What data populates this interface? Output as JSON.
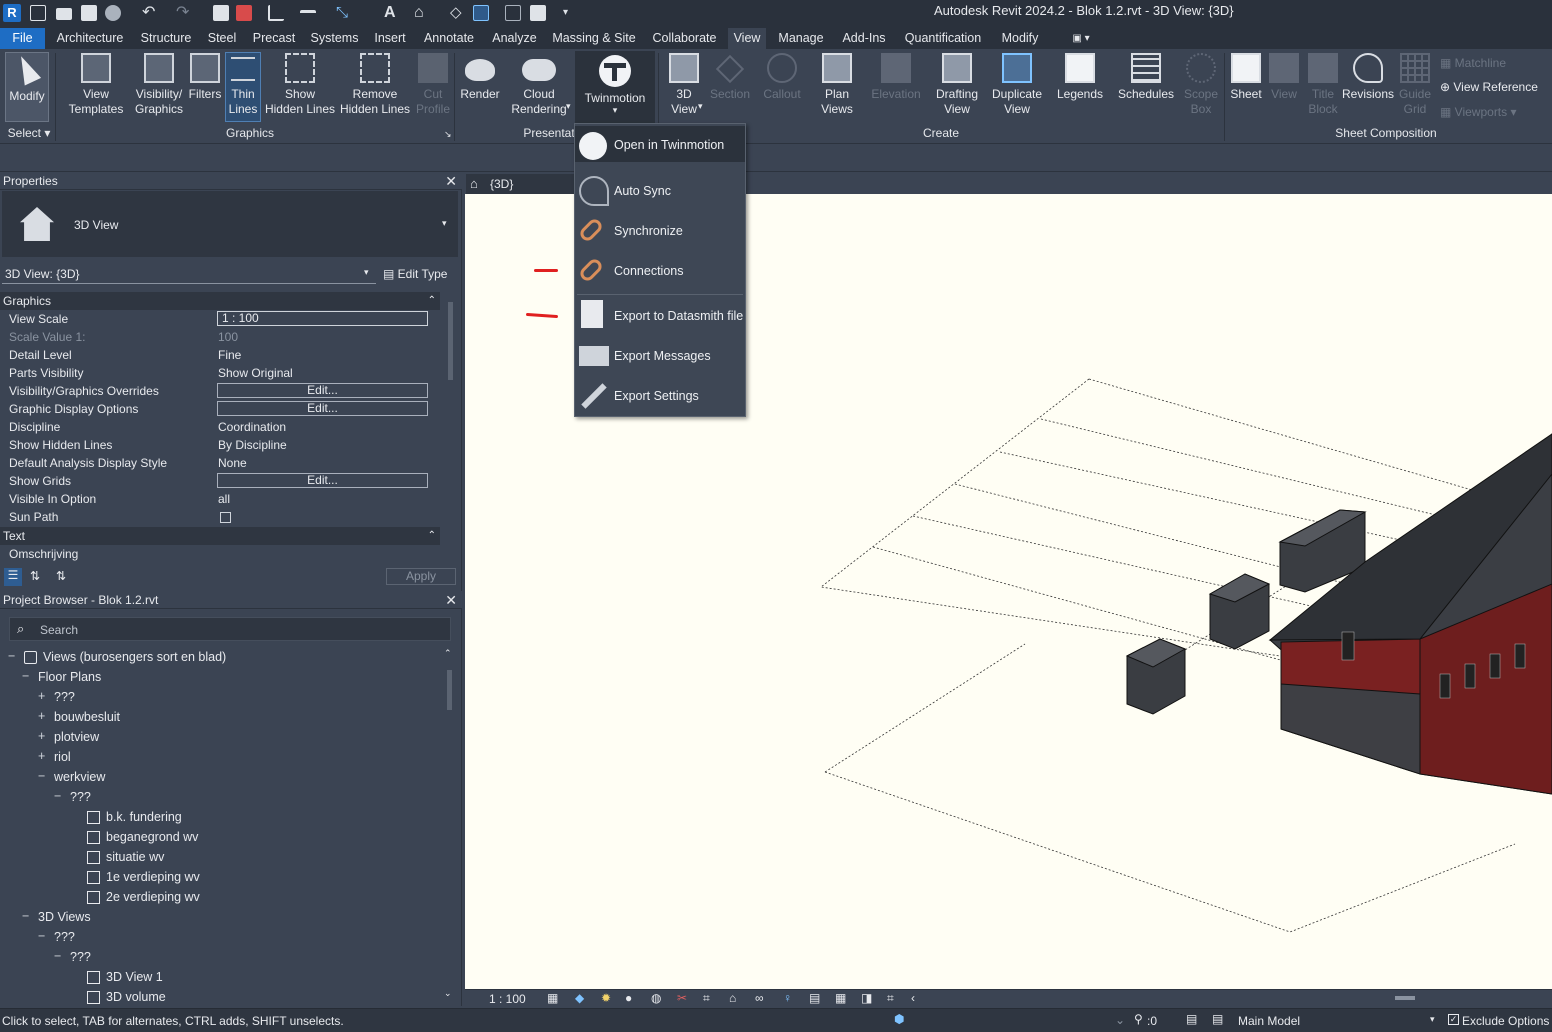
{
  "app_title": "Autodesk Revit 2024.2 - Blok 1.2.rvt - 3D View: {3D}",
  "menu": [
    "File",
    "Architecture",
    "Structure",
    "Steel",
    "Precast",
    "Systems",
    "Insert",
    "Annotate",
    "Analyze",
    "Massing & Site",
    "Collaborate",
    "View",
    "Manage",
    "Add-Ins",
    "Quantification",
    "Modify"
  ],
  "ribbon": {
    "modify": "Modify",
    "select": "Select",
    "view_templates": [
      "View",
      "Templates"
    ],
    "visibility": [
      "Visibility/",
      "Graphics"
    ],
    "filters": "Filters",
    "thin_lines": [
      "Thin",
      "Lines"
    ],
    "show_hidden": [
      "Show",
      "Hidden Lines"
    ],
    "remove_hidden": [
      "Remove",
      "Hidden Lines"
    ],
    "cut_profile": [
      "Cut",
      "Profile"
    ],
    "graphics_panel": "Graphics",
    "render": "Render",
    "cloud_rendering": [
      "Cloud",
      "Rendering"
    ],
    "twinmotion": "Twinmotion",
    "presentation_panel": "Presentat",
    "view3d": [
      "3D",
      "View"
    ],
    "section": "Section",
    "callout": "Callout",
    "plan_views": [
      "Plan",
      "Views"
    ],
    "elevation": "Elevation",
    "drafting_view": [
      "Drafting",
      "View"
    ],
    "duplicate_view": [
      "Duplicate",
      "View"
    ],
    "legends": "Legends",
    "schedules": "Schedules",
    "scope_box": [
      "Scope",
      "Box"
    ],
    "create_panel": "Create",
    "sheet": "Sheet",
    "view": "View",
    "title_block": [
      "Title",
      "Block"
    ],
    "revisions": "Revisions",
    "guide_grid": [
      "Guide",
      "Grid"
    ],
    "matchline": "Matchline",
    "view_reference": "View  Reference",
    "viewports": "Viewports",
    "sheet_comp_panel": "Sheet Composition"
  },
  "twinmotion_menu": [
    "Open in Twinmotion",
    "Auto Sync",
    "Synchronize",
    "Connections",
    "Export to Datasmith file",
    "Export Messages",
    "Export Settings"
  ],
  "properties": {
    "title": "Properties",
    "type_name": "3D View",
    "instance": "3D View: {3D}",
    "edit_type": "Edit Type",
    "group_graphics": "Graphics",
    "rows": [
      {
        "k": "View Scale",
        "v": "1 : 100",
        "kind": "input"
      },
      {
        "k": "Scale Value    1:",
        "v": "100",
        "kind": "dim"
      },
      {
        "k": "Detail Level",
        "v": "Fine"
      },
      {
        "k": "Parts Visibility",
        "v": "Show Original"
      },
      {
        "k": "Visibility/Graphics Overrides",
        "v": "Edit...",
        "kind": "btn"
      },
      {
        "k": "Graphic Display Options",
        "v": "Edit...",
        "kind": "btn"
      },
      {
        "k": "Discipline",
        "v": "Coordination"
      },
      {
        "k": "Show Hidden Lines",
        "v": "By Discipline"
      },
      {
        "k": "Default Analysis Display Style",
        "v": "None"
      },
      {
        "k": "Show Grids",
        "v": "Edit...",
        "kind": "btn"
      },
      {
        "k": "Visible In Option",
        "v": "all"
      },
      {
        "k": "Sun Path",
        "v": "",
        "kind": "check"
      }
    ],
    "group_text": "Text",
    "omschrijving": "Omschrijving",
    "apply": "Apply"
  },
  "browser": {
    "title": "Project Browser - Blok 1.2.rvt",
    "search_placeholder": "Search",
    "nodes": [
      {
        "t": "Views (burosengers sort en blad)",
        "lvl": 0,
        "tw": "−",
        "icon": true
      },
      {
        "t": "Floor Plans",
        "lvl": 1,
        "tw": "−"
      },
      {
        "t": "???",
        "lvl": 2,
        "tw": "+"
      },
      {
        "t": "bouwbesluit",
        "lvl": 2,
        "tw": "+"
      },
      {
        "t": "plotview",
        "lvl": 2,
        "tw": "+"
      },
      {
        "t": "riol",
        "lvl": 2,
        "tw": "+"
      },
      {
        "t": "werkview",
        "lvl": 2,
        "tw": "−"
      },
      {
        "t": "???",
        "lvl": 3,
        "tw": "−"
      },
      {
        "t": "b.k. fundering",
        "lvl": 4,
        "sheet": true
      },
      {
        "t": "beganegrond wv",
        "lvl": 4,
        "sheet": true
      },
      {
        "t": "situatie wv",
        "lvl": 4,
        "sheet": true
      },
      {
        "t": "1e verdieping wv",
        "lvl": 4,
        "sheet": true
      },
      {
        "t": "2e verdieping wv",
        "lvl": 4,
        "sheet": true
      },
      {
        "t": "3D Views",
        "lvl": 1,
        "tw": "−"
      },
      {
        "t": "???",
        "lvl": 2,
        "tw": "−"
      },
      {
        "t": "???",
        "lvl": 3,
        "tw": "−"
      },
      {
        "t": "3D View 1",
        "lvl": 4,
        "sheet": true
      },
      {
        "t": "3D volume",
        "lvl": 4,
        "sheet": true
      }
    ]
  },
  "view_tab": "{3D}",
  "view_scale": "1 : 100",
  "status": {
    "hint": "Click to select, TAB for alternates, CTRL adds, SHIFT unselects.",
    "sel_count": ":0",
    "model": "Main Model",
    "exclude": "Exclude Options"
  }
}
